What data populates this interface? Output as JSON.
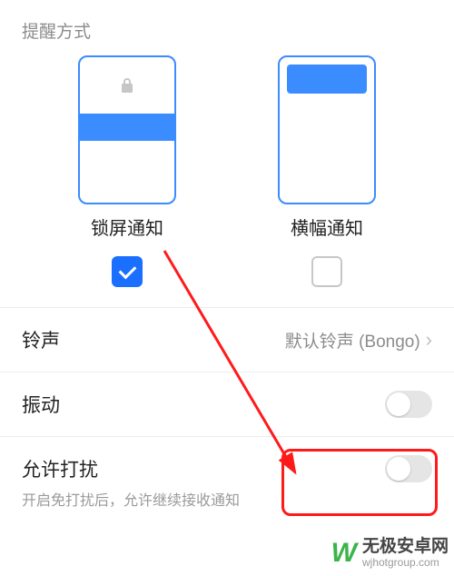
{
  "section_title": "提醒方式",
  "options": {
    "lockscreen": {
      "label": "锁屏通知",
      "checked": true
    },
    "banner": {
      "label": "横幅通知",
      "checked": false
    }
  },
  "rows": {
    "ringtone": {
      "title": "铃声",
      "value": "默认铃声 (Bongo)"
    },
    "vibrate": {
      "title": "振动",
      "toggle_on": false
    },
    "allow_disturb": {
      "title": "允许打扰",
      "subtitle": "开启免打扰后，允许继续接收通知",
      "toggle_on": false
    }
  },
  "watermark": {
    "logo": "W",
    "cn": "无极安卓网",
    "en": "wjhotgroup.com"
  }
}
